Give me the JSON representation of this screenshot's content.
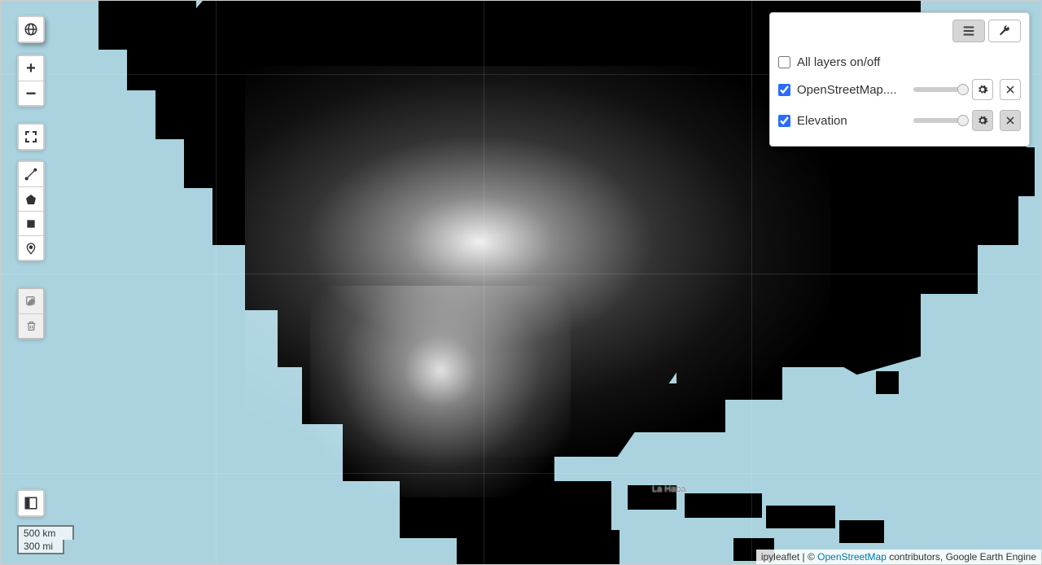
{
  "controls": {
    "globe_title": "Search location",
    "zoom_in": "+",
    "zoom_out": "−",
    "fullscreen_title": "Fullscreen",
    "draw_line_title": "Draw a polyline",
    "draw_polygon_title": "Draw a polygon",
    "draw_rect_title": "Draw a rectangle",
    "draw_marker_title": "Draw a marker",
    "edit_title": "Edit layers",
    "trash_title": "Delete layers",
    "legend_title": "Toggle legend"
  },
  "scale": {
    "km": "500 km",
    "mi": "300 mi"
  },
  "layer_panel": {
    "tab_layers_title": "Layers",
    "tab_tools_title": "Tools",
    "all_label": "All layers on/off",
    "all_checked": false,
    "rows": [
      {
        "name": "OpenStreetMap....",
        "checked": true
      },
      {
        "name": "Elevation",
        "checked": true
      }
    ]
  },
  "map_labels": {
    "la_habana": "La Haba"
  },
  "attribution": {
    "prefix": "ipyleaflet | © ",
    "osm_link": "OpenStreetMap",
    "suffix": " contributors, Google Earth Engine"
  }
}
